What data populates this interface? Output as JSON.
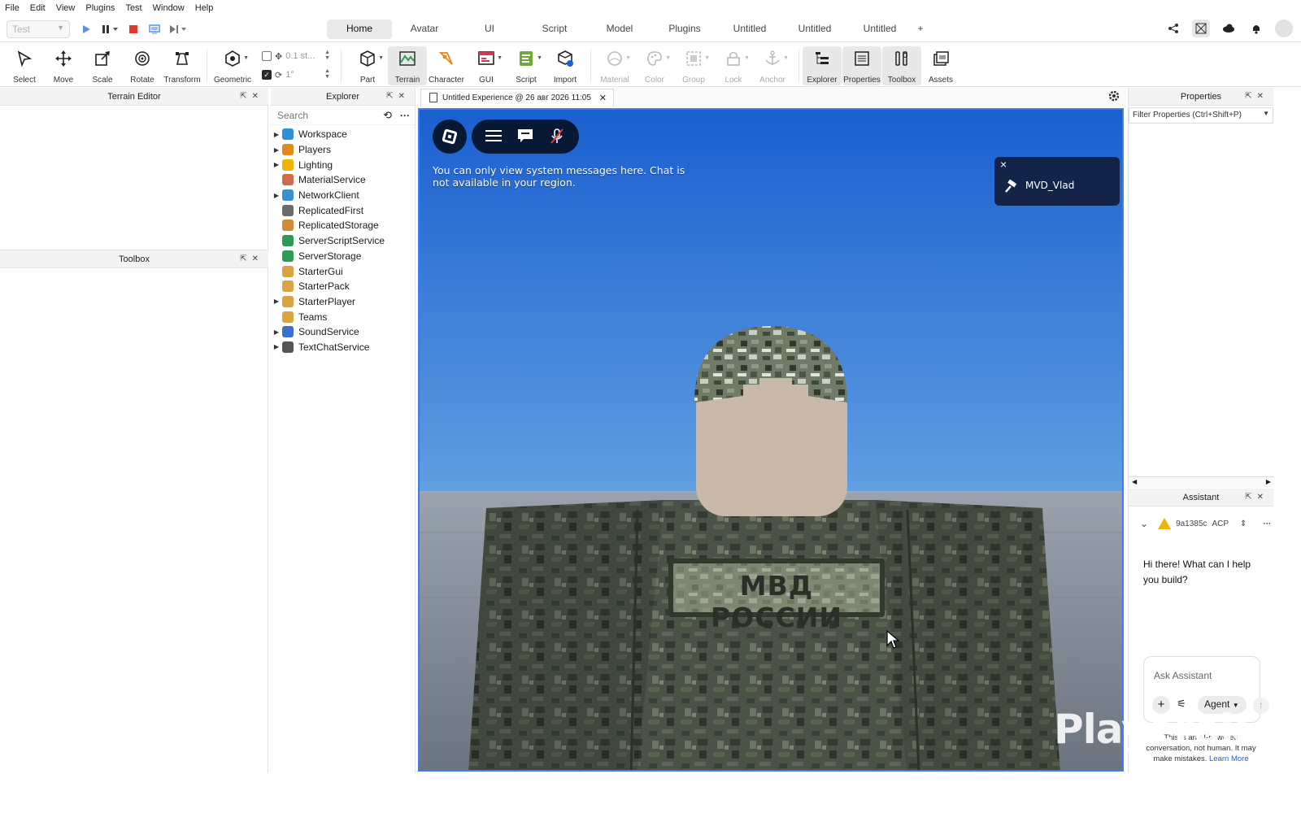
{
  "menu": [
    "File",
    "Edit",
    "View",
    "Plugins",
    "Test",
    "Window",
    "Help"
  ],
  "mode_select": "Test",
  "tabs": [
    "Home",
    "Avatar",
    "UI",
    "Script",
    "Model",
    "Plugins",
    "Untitled",
    "Untitled",
    "Untitled",
    "+"
  ],
  "active_tab": "Home",
  "ribbon": {
    "select": "Select",
    "move": "Move",
    "scale": "Scale",
    "rotate": "Rotate",
    "transform": "Transform",
    "geometric": "Geometric",
    "snap_move": "0.1 st...",
    "snap_rotate": "1°",
    "part": "Part",
    "terrain": "Terrain",
    "character": "Character",
    "gui": "GUI",
    "script": "Script",
    "import": "Import",
    "material": "Material",
    "color": "Color",
    "group": "Group",
    "lock": "Lock",
    "anchor": "Anchor",
    "explorer": "Explorer",
    "properties": "Properties",
    "toolbox": "Toolbox",
    "assets": "Assets"
  },
  "panels": {
    "terrain_editor": "Terrain Editor",
    "toolbox": "Toolbox",
    "explorer": "Explorer",
    "properties": "Properties",
    "assistant": "Assistant"
  },
  "explorer": {
    "search_placeholder": "Search",
    "items": [
      {
        "label": "Workspace",
        "icon": "workspace-globe-icon",
        "expandable": true,
        "color": "#2f8fd8"
      },
      {
        "label": "Players",
        "icon": "players-icon",
        "expandable": true,
        "color": "#e08a1e"
      },
      {
        "label": "Lighting",
        "icon": "lighting-bulb-icon",
        "expandable": true,
        "color": "#f0b400"
      },
      {
        "label": "MaterialService",
        "icon": "material-service-icon",
        "expandable": false,
        "color": "#d06a4a"
      },
      {
        "label": "NetworkClient",
        "icon": "network-client-icon",
        "expandable": true,
        "color": "#3a8fd0"
      },
      {
        "label": "ReplicatedFirst",
        "icon": "replicated-first-icon",
        "expandable": false,
        "color": "#6b6b6b"
      },
      {
        "label": "ReplicatedStorage",
        "icon": "replicated-storage-icon",
        "expandable": false,
        "color": "#d08a3a"
      },
      {
        "label": "ServerScriptService",
        "icon": "server-script-service-icon",
        "expandable": false,
        "color": "#2e9a55"
      },
      {
        "label": "ServerStorage",
        "icon": "server-storage-icon",
        "expandable": false,
        "color": "#2e9a55"
      },
      {
        "label": "StarterGui",
        "icon": "starter-gui-icon",
        "expandable": false,
        "color": "#d9a441"
      },
      {
        "label": "StarterPack",
        "icon": "starter-pack-icon",
        "expandable": false,
        "color": "#d9a441"
      },
      {
        "label": "StarterPlayer",
        "icon": "starter-player-icon",
        "expandable": true,
        "color": "#d9a441"
      },
      {
        "label": "Teams",
        "icon": "teams-icon",
        "expandable": false,
        "color": "#d9a441"
      },
      {
        "label": "SoundService",
        "icon": "sound-service-icon",
        "expandable": true,
        "color": "#3a6fd0"
      },
      {
        "label": "TextChatService",
        "icon": "text-chat-service-icon",
        "expandable": true,
        "color": "#555555"
      }
    ]
  },
  "document_tab": "Untitled Experience @ 26 авг 2026 11:05",
  "viewport": {
    "system_message": "You can only view system messages here. Chat is not available in your region.",
    "notification_name": "MVD_Vlad",
    "patch_text": "МВД РОССИИ",
    "watermark": "Playerok"
  },
  "properties": {
    "filter_placeholder": "Filter Properties (Ctrl+Shift+P)"
  },
  "assistant": {
    "session_id": "9a1385c",
    "session_tag": "ACP",
    "greeting": "Hi there! What can I help you build?",
    "input_placeholder": "Ask Assistant",
    "mode": "Agent",
    "disclaimer": "This is an AI-powered conversation, not human. It may make mistakes.",
    "learn_more": "Learn More"
  },
  "colors": {
    "accent": "#3d7ef0",
    "sky_top": "#1a5fd0",
    "sky_bottom": "#8fc0ea",
    "stop": "#e03a2e"
  }
}
